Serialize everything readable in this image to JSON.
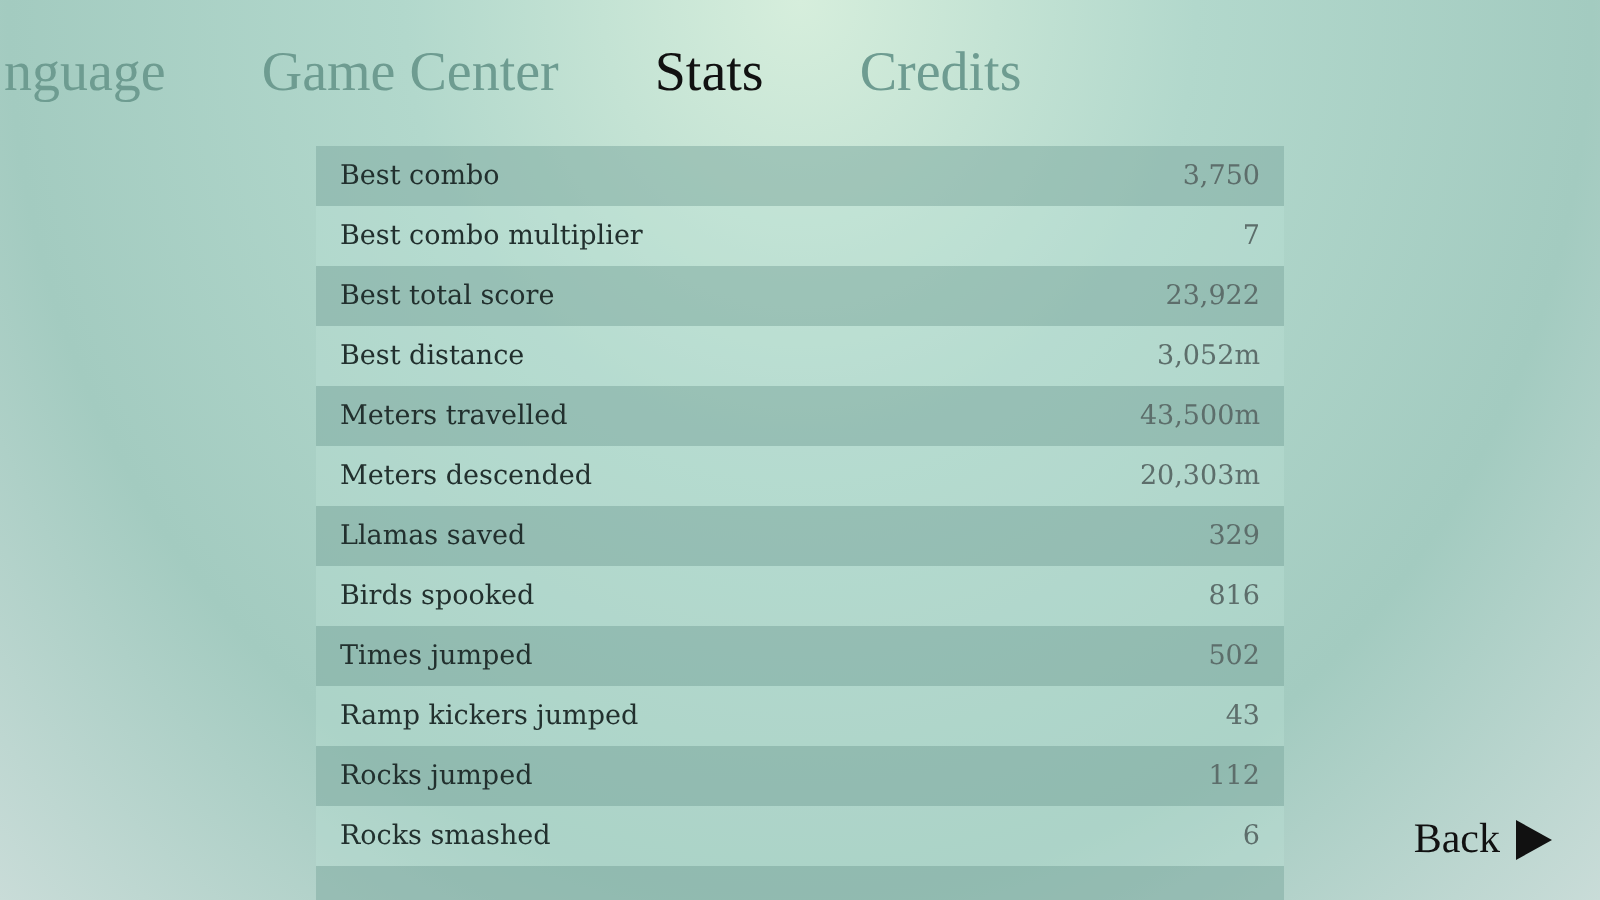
{
  "tabs": [
    {
      "label": "nguage",
      "selected": false
    },
    {
      "label": "Game Center",
      "selected": false
    },
    {
      "label": "Stats",
      "selected": true
    },
    {
      "label": "Credits",
      "selected": false
    }
  ],
  "stats": [
    {
      "label": "Best combo",
      "value": "3,750"
    },
    {
      "label": "Best combo multiplier",
      "value": "7"
    },
    {
      "label": "Best total score",
      "value": "23,922"
    },
    {
      "label": "Best distance",
      "value": "3,052m"
    },
    {
      "label": "Meters travelled",
      "value": "43,500m"
    },
    {
      "label": "Meters descended",
      "value": "20,303m"
    },
    {
      "label": "Llamas saved",
      "value": "329"
    },
    {
      "label": "Birds spooked",
      "value": "816"
    },
    {
      "label": "Times jumped",
      "value": "502"
    },
    {
      "label": "Ramp kickers jumped",
      "value": "43"
    },
    {
      "label": "Rocks jumped",
      "value": "112"
    },
    {
      "label": "Rocks smashed",
      "value": "6"
    }
  ],
  "back_button": {
    "label": "Back"
  }
}
